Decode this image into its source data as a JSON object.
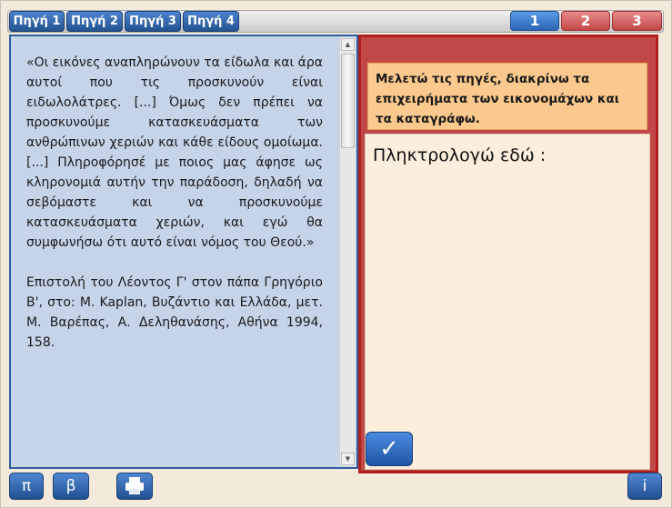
{
  "source_tabs": [
    {
      "label": "Πηγή 1"
    },
    {
      "label": "Πηγή 2"
    },
    {
      "label": "Πηγή 3"
    },
    {
      "label": "Πηγή 4"
    }
  ],
  "pages": [
    {
      "label": "1",
      "state": "active"
    },
    {
      "label": "2",
      "state": "inactive"
    },
    {
      "label": "3",
      "state": "inactive"
    }
  ],
  "source": {
    "quote": "«Οι εικόνες αναπληρώνουν τα είδωλα και άρα αυτοί που τις προσκυνούν είναι ειδωλολάτρες. [...] Όμως δεν πρέπει να προσκυνούμε κατασκευάσματα των ανθρώπινων χεριών και κάθε είδους ομοίωμα. [...] Πληροφόρησέ με ποιος μας άφησε ως κληρονομιά αυτήν την παράδοση, δηλαδή να σεβόμαστε και να προσκυνούμε κατασκευάσματα χεριών, και εγώ θα συμφωνήσω ότι αυτό είναι νόμος του Θεού.»",
    "citation": "Επιστολή του Λέοντος Γ' στον πάπα Γρηγόριο Β', στο: M. Kaplan, Βυζάντιο και Ελλάδα, μετ. Μ. Βαρέπας, Α. Δεληθανάσης, Αθήνα 1994, 158."
  },
  "task": {
    "instruction": "Μελετώ τις πηγές, διακρίνω τα επιχειρήματα των εικονομάχων και τα καταγράφω.",
    "answer_label": "Πληκτρολογώ εδώ :"
  },
  "buttons": {
    "check": "✓",
    "pi": "π",
    "beta": "β",
    "info": "i"
  },
  "icons": {
    "print": "printer-icon",
    "check": "checkmark-icon"
  }
}
